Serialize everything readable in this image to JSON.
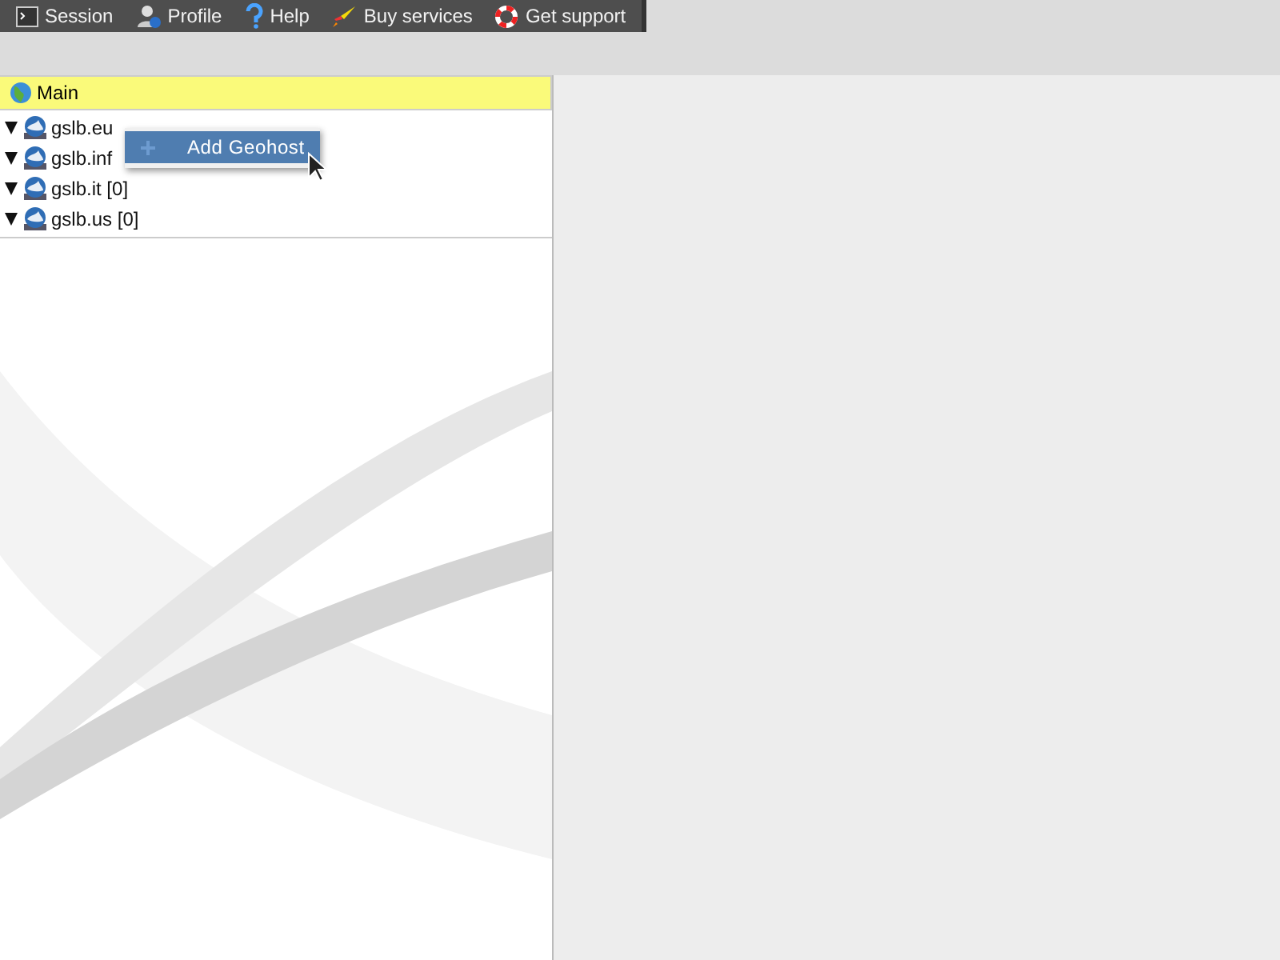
{
  "toolbar": [
    {
      "kind": "session",
      "label": "Session"
    },
    {
      "kind": "profile",
      "label": "Profile"
    },
    {
      "kind": "help",
      "label": "Help"
    },
    {
      "kind": "buy",
      "label": "Buy services"
    },
    {
      "kind": "support",
      "label": "Get support"
    }
  ],
  "tree": {
    "title": "Main",
    "items": [
      {
        "label": "gslb.eu",
        "expanded": true
      },
      {
        "label": "gslb.inf",
        "expanded": true
      },
      {
        "label": "gslb.it [0]",
        "expanded": true
      },
      {
        "label": "gslb.us [0]",
        "expanded": true
      }
    ]
  },
  "context_menu": {
    "items": [
      {
        "label": "Add Geohost",
        "selected": true
      }
    ]
  }
}
